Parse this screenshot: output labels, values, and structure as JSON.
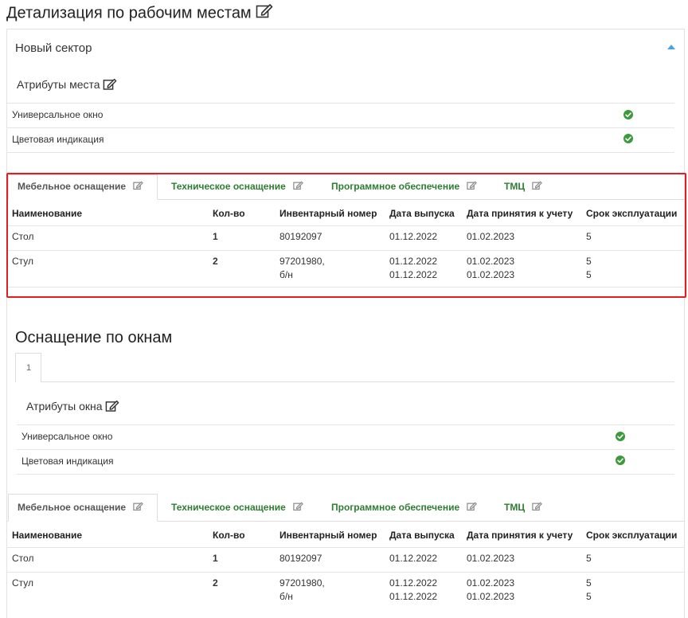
{
  "page_title": "Детализация по рабочим местам",
  "sector": {
    "title": "Новый сектор"
  },
  "place_attrs": {
    "title": "Атрибуты места",
    "items": [
      {
        "label": "Универсальное окно",
        "checked": true
      },
      {
        "label": "Цветовая индикация",
        "checked": true
      }
    ]
  },
  "tabs": [
    "Мебельное оснащение",
    "Техническое оснащение",
    "Программное обеспечение",
    "ТМЦ"
  ],
  "table": {
    "headers": [
      "Наименование",
      "Кол-во",
      "Инвентарный номер",
      "Дата выпуска",
      "Дата принятия к учету",
      "Срок эксплуатации"
    ],
    "rows": [
      {
        "name": "Стол",
        "qty": "1",
        "inv": [
          "80192097"
        ],
        "release": [
          "01.12.2022"
        ],
        "accept": [
          "01.02.2023"
        ],
        "term": [
          "5"
        ]
      },
      {
        "name": "Стул",
        "qty": "2",
        "inv": [
          "97201980,",
          "б/н"
        ],
        "release": [
          "01.12.2022",
          "01.12.2022"
        ],
        "accept": [
          "01.02.2023",
          "01.02.2023"
        ],
        "term": [
          "5",
          "5"
        ]
      }
    ]
  },
  "windows": {
    "title": "Оснащение по окнам",
    "page_tab": "1",
    "attrs_title": "Атрибуты окна",
    "attrs": [
      {
        "label": "Универсальное окно",
        "checked": true
      },
      {
        "label": "Цветовая индикация",
        "checked": true
      }
    ]
  },
  "colors": {
    "accent_green": "#2e7d32",
    "check_green": "#3c9a3c",
    "highlight_red": "#e02020",
    "caret_blue": "#4aa3df"
  },
  "icons": {
    "edit": "edit-icon",
    "check": "check-circle-icon",
    "collapse": "caret-up-icon"
  }
}
